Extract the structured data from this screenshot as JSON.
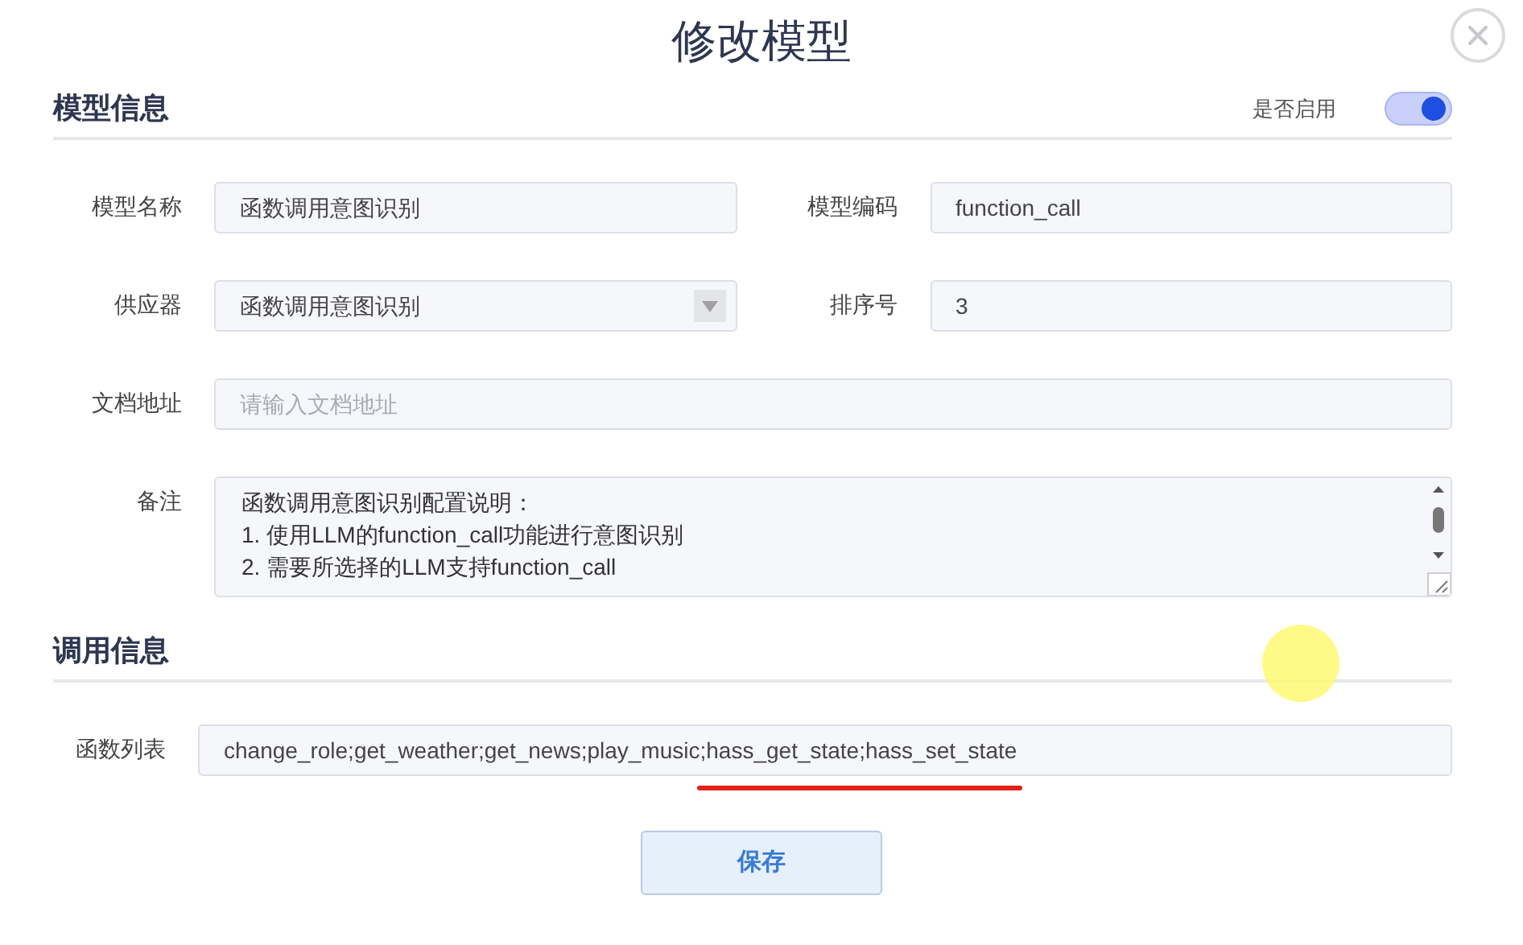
{
  "dialog": {
    "title": "修改模型"
  },
  "sections": [
    {
      "title": "模型信息",
      "toggle": {
        "label": "是否启用",
        "on": true
      },
      "rows": [
        [
          {
            "label": "模型名称",
            "kind": "input",
            "value": "函数调用意图识别"
          },
          {
            "label": "模型编码",
            "kind": "input",
            "value": "function_call"
          }
        ],
        [
          {
            "label": "供应器",
            "kind": "select",
            "value": "函数调用意图识别"
          },
          {
            "label": "排序号",
            "kind": "input",
            "value": "3"
          }
        ],
        [
          {
            "label": "文档地址",
            "kind": "input",
            "placeholder": "请输入文档地址"
          }
        ],
        [
          {
            "label": "备注",
            "kind": "textarea",
            "lines": [
              "函数调用意图识别配置说明：",
              "1. 使用LLM的function_call功能进行意图识别",
              "2. 需要所选择的LLM支持function_call"
            ]
          }
        ]
      ]
    },
    {
      "title": "调用信息",
      "rows": [
        [
          {
            "label": "函数列表",
            "kind": "input",
            "value": "change_role;get_weather;get_news;play_music;hass_get_state;hass_set_state"
          }
        ]
      ]
    }
  ],
  "save_button": {
    "label": "保存"
  }
}
